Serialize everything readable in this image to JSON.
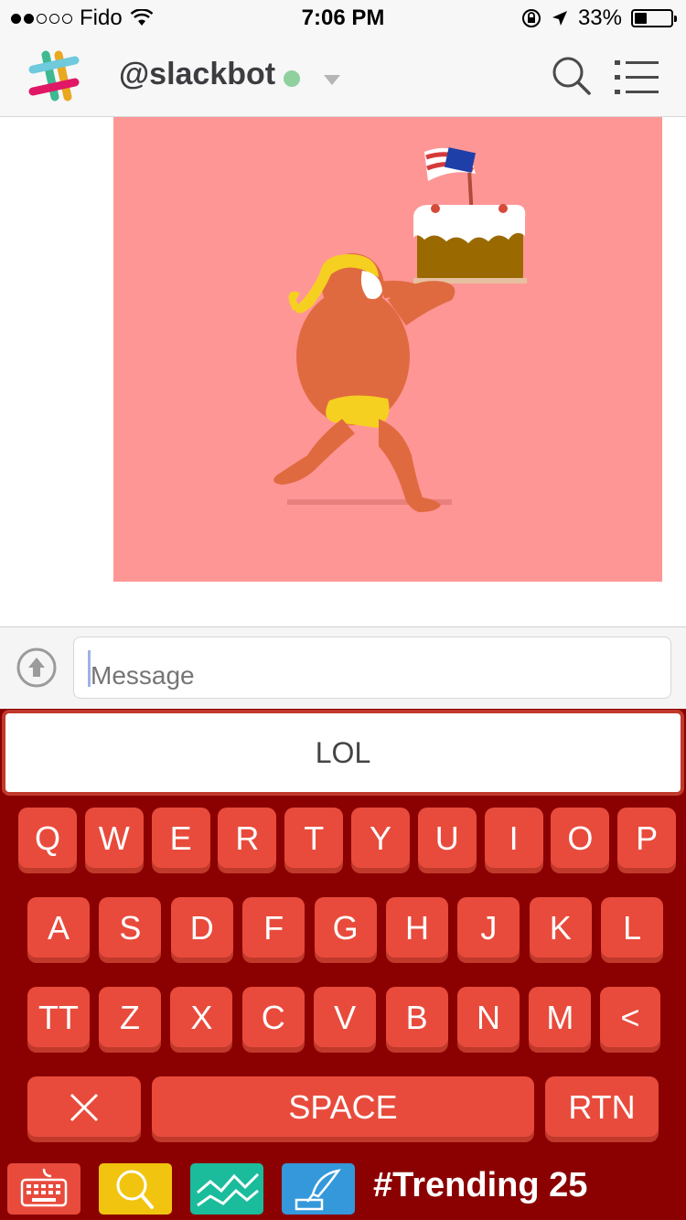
{
  "status_bar": {
    "carrier": "Fido",
    "time": "7:06 PM",
    "battery_percent": "33%",
    "battery_level": 0.33,
    "signal_bars_filled": 2,
    "signal_bars_total": 5
  },
  "header": {
    "channel": "@slackbot",
    "presence_color": "#8fd19e"
  },
  "message": {
    "gif_background": "#ff9696"
  },
  "composer": {
    "placeholder": "Message"
  },
  "suggestion": {
    "text": "LOL"
  },
  "keyboard": {
    "row1": [
      "Q",
      "W",
      "E",
      "R",
      "T",
      "Y",
      "U",
      "I",
      "O",
      "P"
    ],
    "row2": [
      "A",
      "S",
      "D",
      "F",
      "G",
      "H",
      "J",
      "K",
      "L"
    ],
    "row3": [
      "Z",
      "X",
      "C",
      "V",
      "B",
      "N",
      "M"
    ],
    "row3_left": "TT",
    "row3_right": "<",
    "space_label": "SPACE",
    "return_label": "RTN",
    "key_color": "#e84b3c",
    "background": "#8b0000"
  },
  "toolbar": {
    "trending_label": "#Trending 25",
    "buttons": [
      {
        "icon": "keyboard-icon",
        "color": "#e84b3c"
      },
      {
        "icon": "search-icon",
        "color": "#f1c40f"
      },
      {
        "icon": "trending-graph-icon",
        "color": "#1abc9c"
      },
      {
        "icon": "quill-icon",
        "color": "#3498db"
      }
    ]
  }
}
